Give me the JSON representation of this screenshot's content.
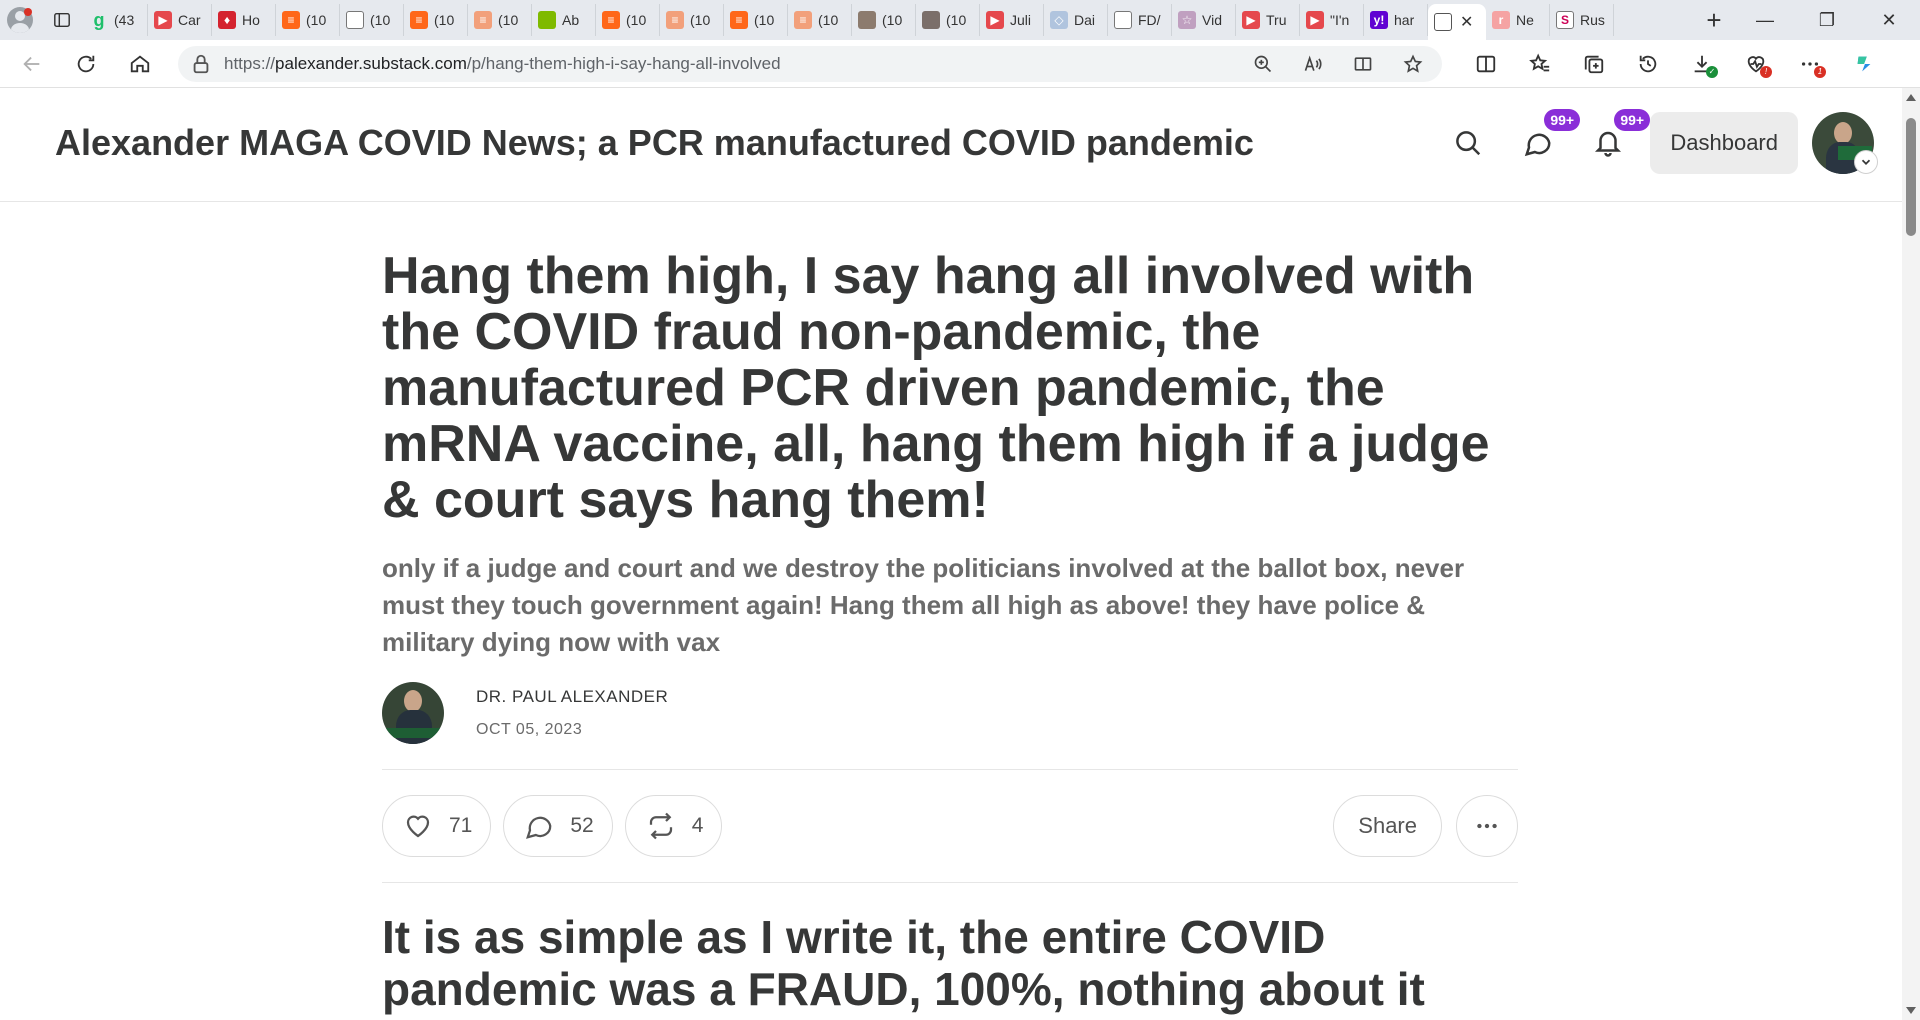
{
  "browser": {
    "tabs": [
      {
        "label": "(43",
        "fav": "g",
        "color": "#1fbf6b"
      },
      {
        "label": "Car",
        "fav": "yt",
        "color": "#e5484d"
      },
      {
        "label": "Ho",
        "fav": "h",
        "color": "#d4232f"
      },
      {
        "label": "(10",
        "fav": "s",
        "color": "#ff6719"
      },
      {
        "label": "(10",
        "fav": "doc",
        "color": "#ffffff"
      },
      {
        "label": "(10",
        "fav": "s",
        "color": "#ff6719"
      },
      {
        "label": "(10",
        "fav": "s",
        "color": "#f2a07b"
      },
      {
        "label": "Ab",
        "fav": "ms",
        "color": "#7fba00"
      },
      {
        "label": "(10",
        "fav": "s",
        "color": "#ff6719"
      },
      {
        "label": "(10",
        "fav": "s",
        "color": "#f2a07b"
      },
      {
        "label": "(10",
        "fav": "s",
        "color": "#ff6719"
      },
      {
        "label": "(10",
        "fav": "s",
        "color": "#f2a07b"
      },
      {
        "label": "(10",
        "fav": "img",
        "color": "#8c7b6e"
      },
      {
        "label": "(10",
        "fav": "img",
        "color": "#7b6f6a"
      },
      {
        "label": "Juli",
        "fav": "yt",
        "color": "#e5484d"
      },
      {
        "label": "Dai",
        "fav": "d",
        "color": "#b0c4de"
      },
      {
        "label": "FD/",
        "fav": "doc",
        "color": "#ffffff"
      },
      {
        "label": "Vid",
        "fav": "star",
        "color": "#c0a0c0"
      },
      {
        "label": "Tru",
        "fav": "yt",
        "color": "#e5484d"
      },
      {
        "label": "\"I'n",
        "fav": "yt",
        "color": "#e5484d"
      },
      {
        "label": "har",
        "fav": "y",
        "color": "#6001d2"
      }
    ],
    "active_tab": {
      "label": "",
      "close": "✕"
    },
    "after_tabs": [
      {
        "label": "Ne",
        "fav": "r",
        "color": "#f5a3a3"
      },
      {
        "label": "Rus",
        "fav": "S",
        "color": "#ffffff"
      }
    ],
    "url_scheme": "https://",
    "url_host": "palexander.substack.com",
    "url_path": "/p/hang-them-high-i-say-hang-all-involved",
    "download_badge": "",
    "ext_badge": "1"
  },
  "site": {
    "title": "Alexander MAGA COVID News; a PCR manufactured COVID pandemic",
    "chat_badge": "99+",
    "bell_badge": "99+",
    "dashboard_label": "Dashboard"
  },
  "post": {
    "title": "Hang them high, I say hang all involved with the COVID fraud non-pandemic, the manufactured PCR driven pandemic, the mRNA vaccine, all, hang them high if a judge & court says hang them!",
    "subtitle": "only if a judge and court and we destroy the politicians involved at the ballot box, never must they touch government again! Hang them all high as above! they have police & military dying now with vax",
    "author": "DR. PAUL ALEXANDER",
    "date": "OCT 05, 2023",
    "likes": "71",
    "comments": "52",
    "restacks": "4",
    "share_label": "Share",
    "body_heading": "It is as simple as I write it, the entire COVID pandemic was a FRAUD, 100%, nothing about it"
  }
}
